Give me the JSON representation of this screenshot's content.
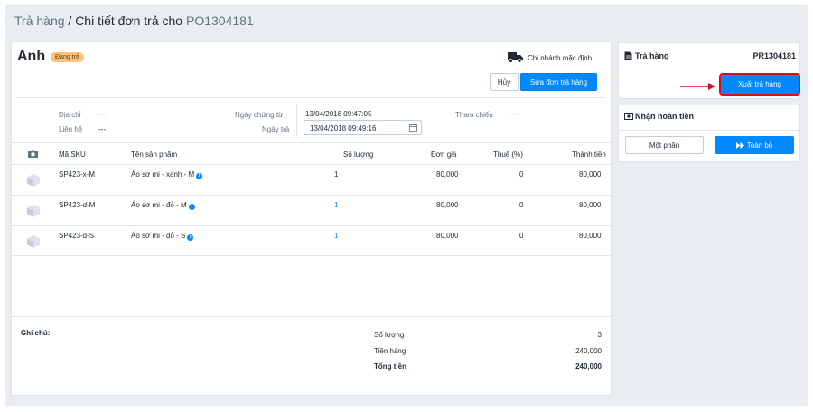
{
  "breadcrumb": {
    "parent": "Trả hàng",
    "separator": " / ",
    "current": "Chi tiết đơn trả cho",
    "order_code": "PO1304181"
  },
  "customer": {
    "name": "Anh",
    "status": "Đang trả"
  },
  "branch": "Chi nhánh mặc định",
  "actions": {
    "cancel": "Hủy",
    "edit": "Sửa đơn trả hàng"
  },
  "info": {
    "address_label": "Địa chỉ",
    "address_value": "---",
    "contact_label": "Liên hệ",
    "contact_value": "---",
    "doc_date_label": "Ngày chứng từ",
    "doc_date_value": "13/04/2018 09:47:05",
    "return_date_label": "Ngày trả",
    "return_date_value": "13/04/2018 09:49:16",
    "ref_label": "Tham chiếu",
    "ref_value": "---"
  },
  "table": {
    "headers": {
      "sku": "Mã SKU",
      "name": "Tên sản phẩm",
      "qty": "Số lượng",
      "price": "Đơn giá",
      "tax": "Thuế (%)",
      "total": "Thành tiền"
    },
    "rows": [
      {
        "sku": "SP423-x-M",
        "name": "Áo sơ mi - xanh - M",
        "qty": "1",
        "price": "80,000",
        "tax": "0",
        "total": "80,000"
      },
      {
        "sku": "SP423-d-M",
        "name": "Áo sơ mi - đỏ - M",
        "qty": "1",
        "price": "80,000",
        "tax": "0",
        "total": "80,000"
      },
      {
        "sku": "SP423-d-S",
        "name": "Áo sơ mi - đỏ - S",
        "qty": "1",
        "price": "80,000",
        "tax": "0",
        "total": "80,000"
      }
    ]
  },
  "note_label": "Ghi chú:",
  "summary": {
    "qty_label": "Số lượng",
    "qty_value": "3",
    "goods_label": "Tiền hàng",
    "goods_value": "240,000",
    "total_label": "Tổng tiền",
    "total_value": "240,000"
  },
  "return_panel": {
    "title": "Trả hàng",
    "code": "PR1304181",
    "export_button": "Xuất trả hàng"
  },
  "refund_panel": {
    "title": "Nhận hoàn tiền",
    "partial_button": "Một phần",
    "full_button": "Toàn bộ"
  },
  "colors": {
    "accent": "#0088ff",
    "badge": "#fdc080",
    "highlight": "#d0121b"
  },
  "icons": {
    "truck": "truck-icon",
    "camera": "camera-icon",
    "product": "box-icon",
    "calendar": "calendar-icon",
    "info": "info-icon",
    "document": "document-icon",
    "money": "money-icon",
    "forward": "forward-icon"
  }
}
